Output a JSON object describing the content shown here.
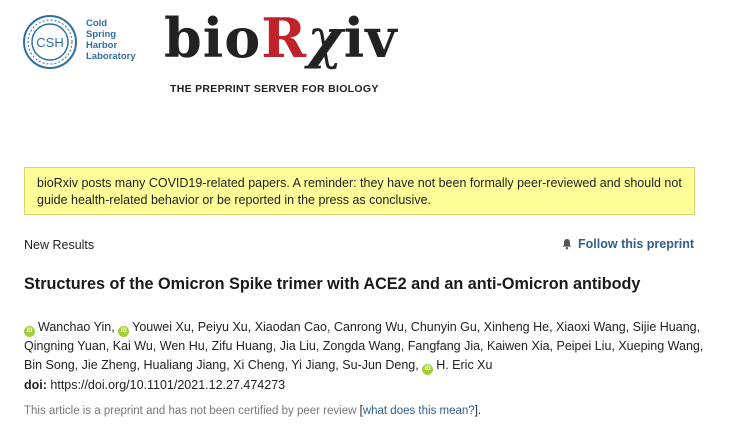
{
  "header": {
    "csh_initials": "CSH",
    "csh_lines": [
      "Cold",
      "Spring",
      "Harbor",
      "Laboratory"
    ],
    "brand_parts": {
      "a": "bio",
      "b": "R",
      "c": "χ",
      "d": "iv"
    },
    "tagline": "THE PREPRINT SERVER FOR BIOLOGY"
  },
  "notice": {
    "text": "bioRxiv posts many COVID19-related papers. A reminder: they have not been formally peer-reviewed and should not guide health-related behavior or be reported in the press as conclusive."
  },
  "article": {
    "section": "New Results",
    "follow_label": "Follow this preprint",
    "title": "Structures of the Omicron Spike trimer with ACE2 and an anti-Omicron antibody",
    "orcid_icon_text": "iD",
    "author_first": "Wanchao Yin,",
    "author_second": "Youwei Xu, Peiyu Xu, Xiaodan Cao, Canrong Wu, Chunyin Gu, Xinheng He, Xiaoxi Wang, Sijie Huang, Qingning Yuan, Kai Wu, Wen Hu, Zifu Huang, Jia Liu, Zongda Wang, Fangfang Jia, Kaiwen Xia, Peipei Liu, Xueping Wang, Bin Song, Jie Zheng, Hualiang Jiang, Xi Cheng, Yi Jiang, Su-Jun Deng,",
    "author_last": "H. Eric Xu",
    "doi_label": "doi:",
    "doi_value": "https://doi.org/10.1101/2021.12.27.474273",
    "disclaimer_text": "This article is a preprint and has not been certified by peer review",
    "disclaimer_link": "what does this mean?",
    "bracket_open": "[",
    "bracket_close": "]."
  },
  "colors": {
    "brand_red": "#c0232c",
    "csh_blue": "#2f6fa7",
    "notice_bg": "#ffff99",
    "link_blue": "#2f5f8f",
    "orcid_green": "#a6ce39"
  },
  "icons": [
    "csh-logo-icon",
    "bell-icon",
    "orcid-icon"
  ]
}
